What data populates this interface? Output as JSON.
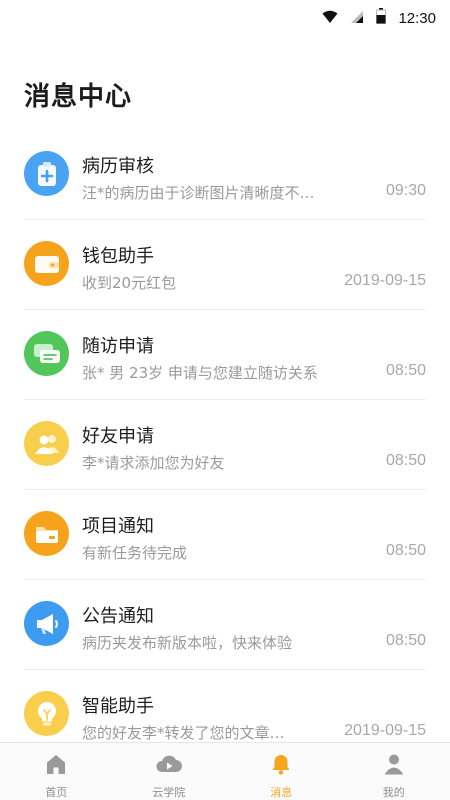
{
  "status_bar": {
    "time": "12:30",
    "icons": [
      "wifi-icon",
      "cell-signal-icon",
      "battery-icon"
    ]
  },
  "page_title": "消息中心",
  "messages": [
    {
      "title": "病历审核",
      "preview": "汪*的病历由于诊断图片清晰度不…",
      "time": "09:30",
      "icon": "medical-record-icon",
      "color": "#4aa3f2"
    },
    {
      "title": "钱包助手",
      "preview": "收到20元红包",
      "time": "2019-09-15",
      "icon": "wallet-icon",
      "color": "#f7a21b"
    },
    {
      "title": "随访申请",
      "preview": "张* 男 23岁 申请与您建立随访关系",
      "time": "08:50",
      "icon": "chat-bubble-icon",
      "color": "#52c65a"
    },
    {
      "title": "好友申请",
      "preview": "李*请求添加您为好友",
      "time": "08:50",
      "icon": "friends-icon",
      "color": "#f8cf4c"
    },
    {
      "title": "项目通知",
      "preview": "有新任务待完成",
      "time": "08:50",
      "icon": "folder-icon",
      "color": "#f7a21b"
    },
    {
      "title": "公告通知",
      "preview": "病历夹发布新版本啦，快来体验",
      "time": "08:50",
      "icon": "megaphone-icon",
      "color": "#3d9bf0"
    },
    {
      "title": "智能助手",
      "preview": "您的好友李*转发了您的文章…",
      "time": "2019-09-15",
      "icon": "lightbulb-icon",
      "color": "#f8cf4c"
    }
  ],
  "tab_bar": {
    "tabs": [
      {
        "label": "首页",
        "icon": "home-icon"
      },
      {
        "label": "云学院",
        "icon": "cloud-play-icon"
      },
      {
        "label": "消息",
        "icon": "bell-icon"
      },
      {
        "label": "我的",
        "icon": "person-icon"
      }
    ],
    "active": "消息",
    "active_color": "#f5a61d",
    "inactive_color": "#9a9a9a"
  }
}
